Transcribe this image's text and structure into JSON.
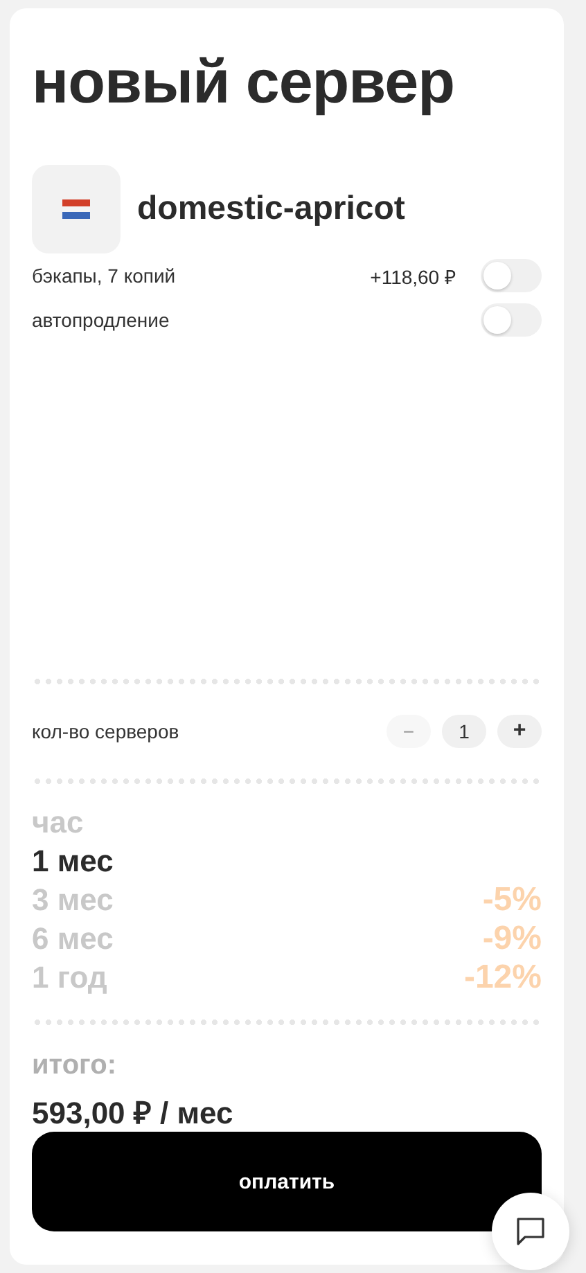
{
  "title": "новый сервер",
  "server": {
    "name": "domestic-apricot"
  },
  "options": [
    {
      "label": "бэкапы, 7 копий",
      "price": "+118,60 ₽",
      "on": false
    },
    {
      "label": "автопродление",
      "on": false
    }
  ],
  "quantity": {
    "label": "кол-во серверов",
    "value": "1",
    "minus": "−",
    "plus": "+",
    "minus_disabled": true
  },
  "periods": [
    {
      "label": "час",
      "selected": false
    },
    {
      "label": "1 мес",
      "selected": true
    },
    {
      "label": "3 мес",
      "selected": false,
      "discount": "-5%"
    },
    {
      "label": "6 мес",
      "selected": false,
      "discount": "-9%"
    },
    {
      "label": "1 год",
      "selected": false,
      "discount": "-12%"
    }
  ],
  "total": {
    "label": "итого:",
    "value": "593,00 ₽ / мес"
  },
  "pay_button": "оплатить"
}
